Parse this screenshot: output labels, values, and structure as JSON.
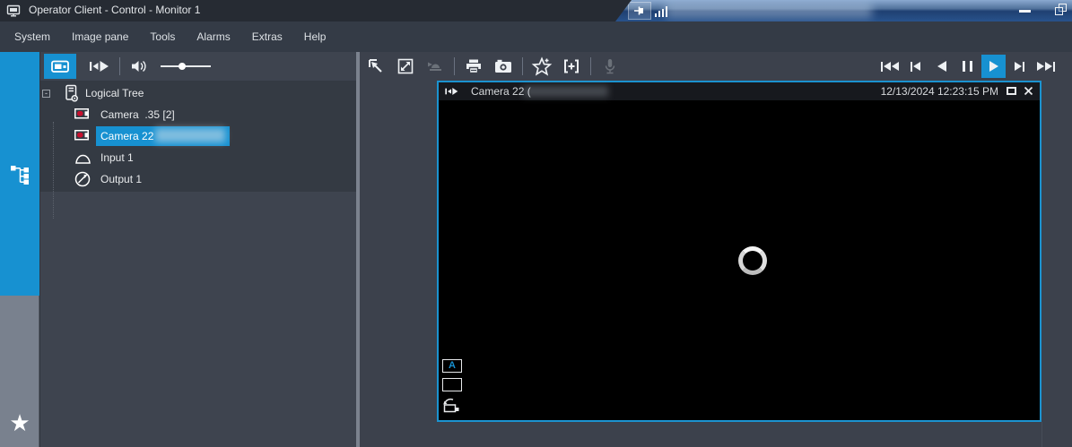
{
  "window": {
    "title": "Operator Client - Control - Monitor 1"
  },
  "titlebar": {
    "icons": [
      "app-monitor-icon",
      "pin-icon",
      "signal-bars-icon",
      "minimize-icon",
      "restore-icon"
    ],
    "redacted_region": true
  },
  "menubar": {
    "items": [
      "System",
      "Image pane",
      "Tools",
      "Alarms",
      "Extras",
      "Help"
    ]
  },
  "sidebar": {
    "tabs": [
      {
        "name": "logical-tree-tab",
        "icon": "tree-structure-icon",
        "active": true
      },
      {
        "name": "favorites-tab",
        "icon": "star-icon",
        "star": "★",
        "active": false
      }
    ]
  },
  "tree_panel": {
    "toolbar": {
      "icons": [
        "show-image-pane",
        "start-instant-playback",
        "speaker"
      ],
      "volume_percent": 35,
      "active_button": "show-image-pane"
    },
    "tree": {
      "root": {
        "label": "Logical Tree",
        "expander": "-"
      },
      "items": [
        {
          "icon": "camera",
          "label": "Camera  .35 [2]",
          "selected": false
        },
        {
          "icon": "camera",
          "label": "Camera 22 ",
          "selected": true,
          "redacted_suffix": true
        },
        {
          "icon": "input",
          "label": "Input 1",
          "selected": false
        },
        {
          "icon": "output",
          "label": "Output 1",
          "selected": false
        }
      ]
    }
  },
  "main_toolbar": {
    "icons": [
      "arrange-panes",
      "maximize-pane",
      "alarm-disabled",
      "print",
      "snapshot",
      "add-favorite",
      "add-bookmark",
      "microphone-disabled"
    ]
  },
  "playback": {
    "buttons": [
      "fast-rewind",
      "step-back",
      "play-backward",
      "pause",
      "play",
      "step-forward",
      "fast-forward"
    ],
    "active": "play"
  },
  "image_pane": {
    "header": {
      "icon": "instant-playback",
      "title": "Camera 22 (",
      "redacted_suffix": true,
      "timestamp": "12/13/2024 12:23:15 PM",
      "buttons": [
        "maximize-pane",
        "close-pane"
      ]
    },
    "overlay_icons": [
      {
        "name": "text-overlay-toggle",
        "label": "A"
      },
      {
        "name": "frame-toggle"
      },
      {
        "name": "camera-replay"
      }
    ],
    "state": "loading-spinner"
  },
  "colors": {
    "accent": "#1791d1",
    "pane_border": "#1b93d0",
    "titlebar_blue": "#28528b",
    "panel_bg": "#3e444f",
    "tree_bg": "#343a43",
    "menubar_bg": "#343b46",
    "video_bg": "#000000",
    "camera_icon_red": "#c8102e"
  }
}
